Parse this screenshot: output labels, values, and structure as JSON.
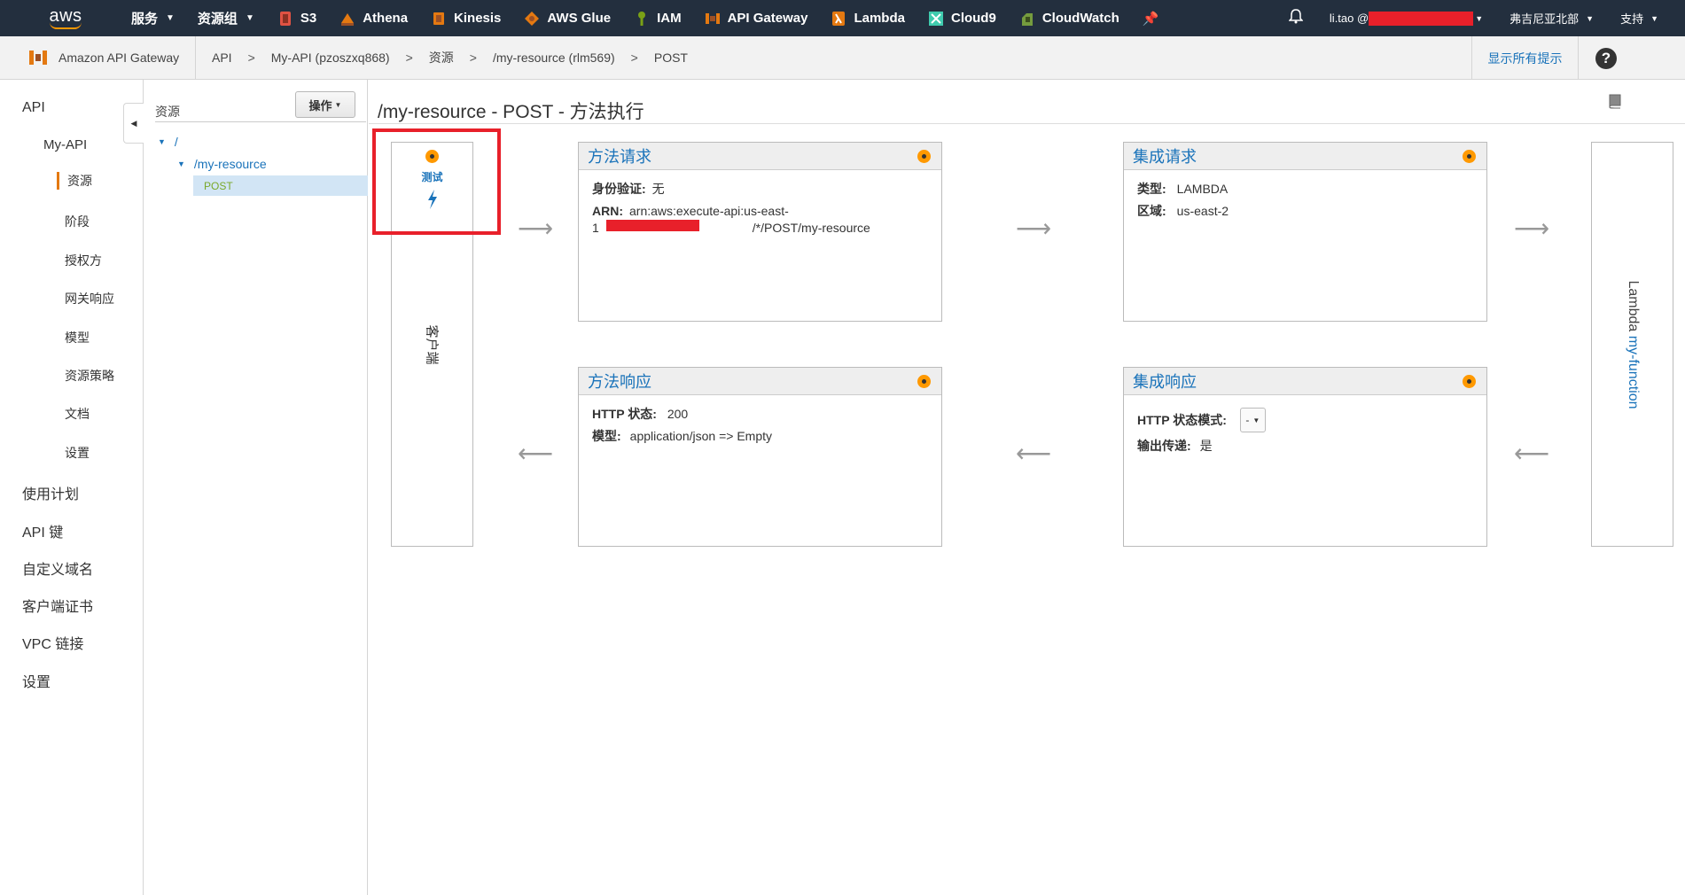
{
  "topnav": {
    "logo": "aws",
    "services_label": "服务",
    "resource_groups_label": "资源组",
    "pinned": [
      {
        "name": "S3",
        "icon": "s3-icon",
        "color": "#e05243"
      },
      {
        "name": "Athena",
        "icon": "athena-icon",
        "color": "#e47911"
      },
      {
        "name": "Kinesis",
        "icon": "kinesis-icon",
        "color": "#e47911"
      },
      {
        "name": "AWS Glue",
        "icon": "glue-icon",
        "color": "#e47911"
      },
      {
        "name": "IAM",
        "icon": "iam-icon",
        "color": "#7aa116"
      },
      {
        "name": "API Gateway",
        "icon": "api-gateway-icon",
        "color": "#e47911"
      },
      {
        "name": "Lambda",
        "icon": "lambda-icon",
        "color": "#e47911"
      },
      {
        "name": "Cloud9",
        "icon": "cloud9-icon",
        "color": "#3fcbae"
      },
      {
        "name": "CloudWatch",
        "icon": "cloudwatch-icon",
        "color": "#759c3e"
      }
    ],
    "user": "li.tao @",
    "region": "弗吉尼亚北部",
    "support": "支持"
  },
  "breadcrumb": {
    "service": "Amazon API Gateway",
    "items": [
      "API",
      "My-API (pzoszxq868)",
      "资源",
      "/my-resource (rlm569)",
      "POST"
    ],
    "show_tips": "显示所有提示",
    "help": "?"
  },
  "leftnav": {
    "api": "API",
    "my_api": "My-API",
    "sub_items": [
      "资源",
      "阶段",
      "授权方",
      "网关响应",
      "模型",
      "资源策略",
      "文档",
      "设置"
    ],
    "bottom_items": [
      "使用计划",
      "API 键",
      "自定义域名",
      "客户端证书",
      "VPC 链接",
      "设置"
    ]
  },
  "tree": {
    "title": "资源",
    "actions": "操作",
    "root": "/",
    "resource": "/my-resource",
    "method": "POST"
  },
  "main": {
    "title": "/my-resource - POST - 方法执行",
    "client": "客户端",
    "test": "测试",
    "method_request": {
      "title": "方法请求",
      "auth_label": "身份验证:",
      "auth_value": "无",
      "arn_label": "ARN:",
      "arn_line1": "arn:aws:execute-api:us-east-",
      "arn_line2_start": "1",
      "arn_line2_end": "/*/POST/my-resource"
    },
    "integration_request": {
      "title": "集成请求",
      "type_label": "类型:",
      "type_value": "LAMBDA",
      "region_label": "区域:",
      "region_value": "us-east-2"
    },
    "method_response": {
      "title": "方法响应",
      "status_label": "HTTP 状态:",
      "status_value": "200",
      "model_label": "模型:",
      "model_value": "application/json => Empty"
    },
    "integration_response": {
      "title": "集成响应",
      "pattern_label": "HTTP 状态模式:",
      "pattern_value": "-",
      "passthrough_label": "输出传递:",
      "passthrough_value": "是"
    },
    "lambda_prefix": "Lambda",
    "lambda_function": "my-function"
  },
  "colors": {
    "nav_bg": "#232f3e",
    "accent": "#ff9900",
    "link": "#1a73ba",
    "highlight": "#e8202a"
  }
}
